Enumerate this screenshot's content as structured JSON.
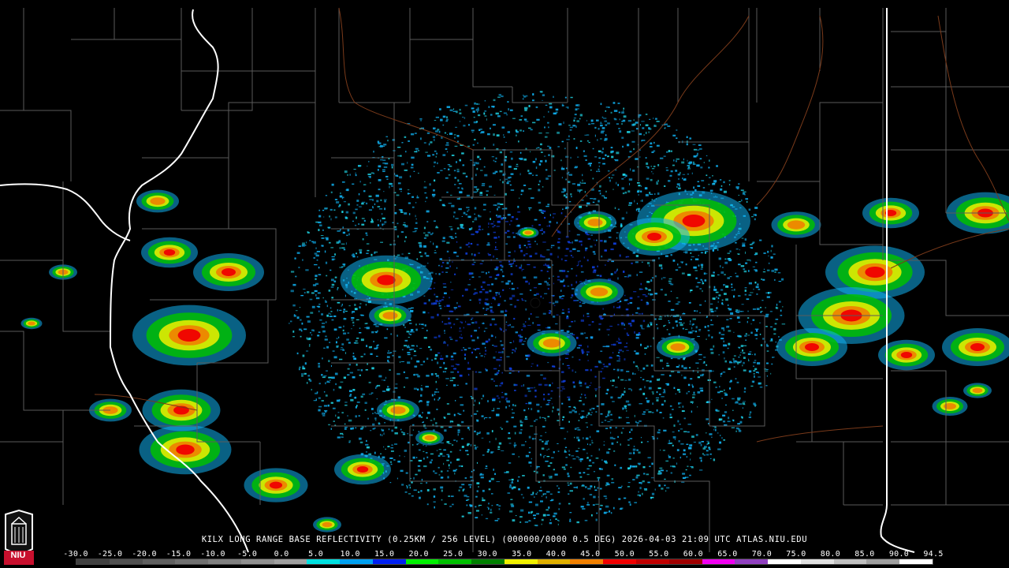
{
  "map": {
    "radar_site_marker": "radar-site-dot",
    "background_color": "#000000",
    "county_line_color": "#5a5a5a",
    "road_color": "#7a3a1a",
    "state_line_color": "#ffffff"
  },
  "caption": {
    "text": "KILX LONG RANGE BASE REFLECTIVITY (0.25KM / 256 LEVEL) (000000/0000 0.5 DEG) 2026-04-03 21:09 UTC  ATLAS.NIU.EDU"
  },
  "scale": {
    "labels": [
      "-30.0",
      "-25.0",
      "-20.0",
      "-15.0",
      "-10.0",
      "-5.0",
      "0.0",
      "5.0",
      "10.0",
      "15.0",
      "20.0",
      "25.0",
      "30.0",
      "35.0",
      "40.0",
      "45.0",
      "50.0",
      "55.0",
      "60.0",
      "65.0",
      "70.0",
      "75.0",
      "80.0",
      "85.0",
      "90.0",
      "94.5"
    ],
    "colors": [
      "#404040",
      "#505050",
      "#606060",
      "#707070",
      "#808080",
      "#909090",
      "#a0a0a0",
      "#00e0e0",
      "#00a0f0",
      "#0020f0",
      "#00f000",
      "#00c000",
      "#008000",
      "#f0f000",
      "#e0b000",
      "#f08000",
      "#f00000",
      "#c00000",
      "#a00000",
      "#f000f0",
      "#9040c0",
      "#ffffff",
      "#e0e0e0",
      "#c0c0c0",
      "#a0a0a0",
      "#ffffff"
    ]
  },
  "logo": {
    "text": "NIU",
    "icon": "niu-tower-logo-icon"
  }
}
